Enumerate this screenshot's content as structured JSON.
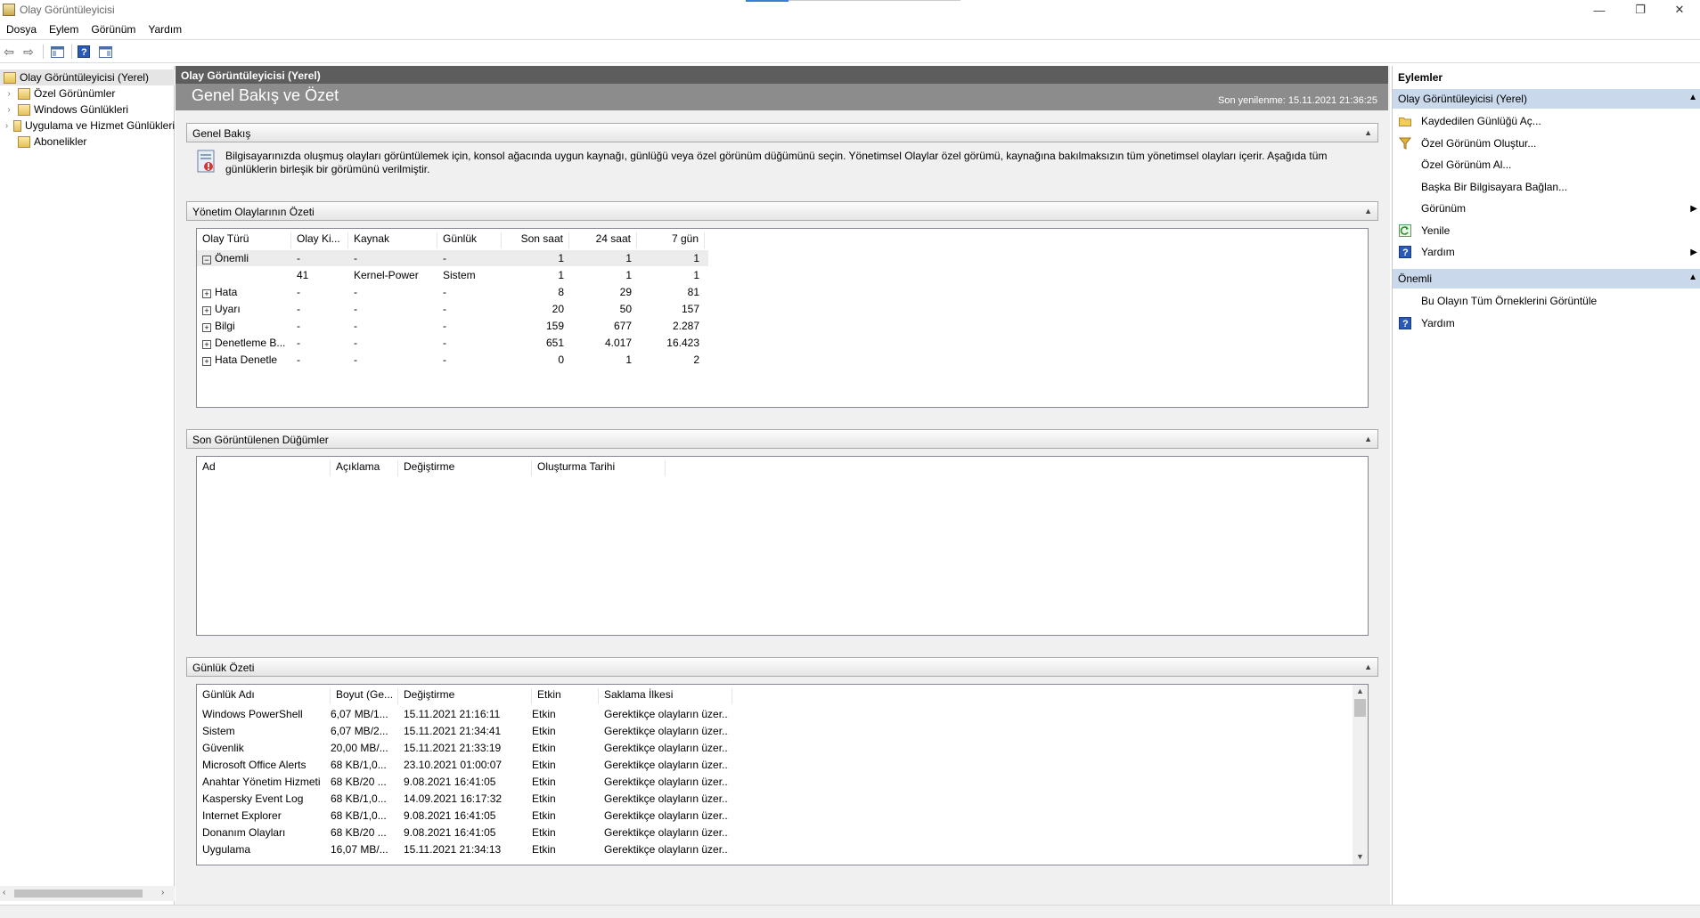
{
  "window": {
    "title": "Olay Görüntüleyicisi"
  },
  "menu": [
    "Dosya",
    "Eylem",
    "Görünüm",
    "Yardım"
  ],
  "tree": [
    {
      "label": "Olay Görüntüleyicisi (Yerel)",
      "selected": true
    },
    {
      "label": "Özel Görünümler"
    },
    {
      "label": "Windows Günlükleri"
    },
    {
      "label": "Uygulama ve Hizmet Günlükleri"
    },
    {
      "label": "Abonelikler"
    }
  ],
  "center": {
    "header": "Olay Görüntüleyicisi (Yerel)",
    "title": "Genel Bakış ve Özet",
    "refreshed": "Son yenilenme: 15.11.2021 21:36:25",
    "overview": {
      "title": "Genel Bakış",
      "text": "Bilgisayarınızda oluşmuş olayları görüntülemek için, konsol ağacında uygun kaynağı, günlüğü veya özel görünüm düğümünü seçin. Yönetimsel Olaylar özel görümü, kaynağına bakılmaksızın tüm yönetimsel olayları içerir. Aşağıda tüm günlüklerin birleşik bir görümünü verilmiştir."
    },
    "summary": {
      "title": "Yönetim Olaylarının Özeti",
      "columns": [
        "Olay Türü",
        "Olay Ki...",
        "Kaynak",
        "Günlük",
        "Son saat",
        "24 saat",
        "7 gün"
      ],
      "rows": [
        [
          "Önemli",
          "-",
          "-",
          "-",
          "1",
          "1",
          "1"
        ],
        [
          "",
          "41",
          "Kernel-Power",
          "Sistem",
          "1",
          "1",
          "1"
        ],
        [
          "Hata",
          "-",
          "-",
          "-",
          "8",
          "29",
          "81"
        ],
        [
          "Uyarı",
          "-",
          "-",
          "-",
          "20",
          "50",
          "157"
        ],
        [
          "Bilgi",
          "-",
          "-",
          "-",
          "159",
          "677",
          "2.287"
        ],
        [
          "Denetleme B...",
          "-",
          "-",
          "-",
          "651",
          "4.017",
          "16.423"
        ],
        [
          "Hata Denetle",
          "-",
          "-",
          "-",
          "0",
          "1",
          "2"
        ]
      ]
    },
    "recent": {
      "title": "Son Görüntülenen Düğümler",
      "columns": [
        "Ad",
        "Açıklama",
        "Değiştirme",
        "Oluşturma Tarihi"
      ]
    },
    "logs": {
      "title": "Günlük Özeti",
      "columns": [
        "Günlük Adı",
        "Boyut (Ge...",
        "Değiştirme",
        "Etkin",
        "Saklama İlkesi"
      ],
      "rows": [
        [
          "Windows PowerShell",
          "6,07 MB/1...",
          "15.11.2021 21:16:11",
          "Etkin",
          "Gerektikçe olayların üzer..."
        ],
        [
          "Sistem",
          "6,07 MB/2...",
          "15.11.2021 21:34:41",
          "Etkin",
          "Gerektikçe olayların üzer..."
        ],
        [
          "Güvenlik",
          "20,00 MB/...",
          "15.11.2021 21:33:19",
          "Etkin",
          "Gerektikçe olayların üzer..."
        ],
        [
          "Microsoft Office Alerts",
          "68 KB/1,0...",
          "23.10.2021 01:00:07",
          "Etkin",
          "Gerektikçe olayların üzer..."
        ],
        [
          "Anahtar Yönetim Hizmeti",
          "68 KB/20 ...",
          "9.08.2021 16:41:05",
          "Etkin",
          "Gerektikçe olayların üzer..."
        ],
        [
          "Kaspersky Event Log",
          "68 KB/1,0...",
          "14.09.2021 16:17:32",
          "Etkin",
          "Gerektikçe olayların üzer..."
        ],
        [
          "Internet Explorer",
          "68 KB/1,0...",
          "9.08.2021 16:41:05",
          "Etkin",
          "Gerektikçe olayların üzer..."
        ],
        [
          "Donanım Olayları",
          "68 KB/20 ...",
          "9.08.2021 16:41:05",
          "Etkin",
          "Gerektikçe olayların üzer..."
        ],
        [
          "Uygulama",
          "16,07 MB/...",
          "15.11.2021 21:34:13",
          "Etkin",
          "Gerektikçe olayların üzer..."
        ]
      ]
    }
  },
  "actions": {
    "title": "Eylemler",
    "group1": "Olay Görüntüleyicisi (Yerel)",
    "items1": [
      {
        "label": "Kaydedilen Günlüğü Aç...",
        "icon": "folder-icon"
      },
      {
        "label": "Özel Görünüm Oluştur...",
        "icon": "filter-icon"
      },
      {
        "label": "Özel Görünüm Al...",
        "icon": ""
      },
      {
        "label": "Başka Bir Bilgisayara Bağlan...",
        "icon": ""
      },
      {
        "label": "Görünüm",
        "icon": "",
        "submenu": true
      },
      {
        "label": "Yenile",
        "icon": "refresh-icon"
      },
      {
        "label": "Yardım",
        "icon": "help-icon",
        "submenu": true
      }
    ],
    "group2": "Önemli",
    "items2": [
      {
        "label": "Bu Olayın Tüm Örneklerini Görüntüle",
        "icon": ""
      },
      {
        "label": "Yardım",
        "icon": "help-icon"
      }
    ]
  }
}
